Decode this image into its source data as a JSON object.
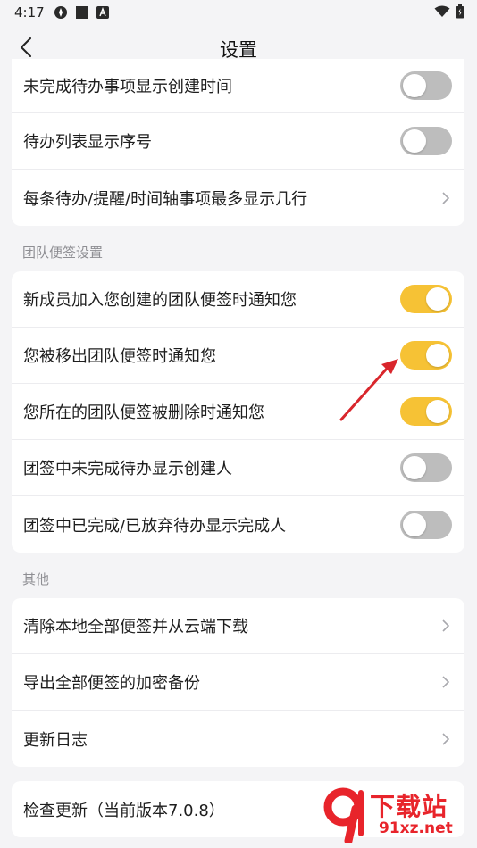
{
  "status": {
    "time": "4:17",
    "icons": [
      "settings-app-icon",
      "square-icon",
      "a-badge-icon",
      "wifi-icon",
      "battery-icon"
    ]
  },
  "header": {
    "title": "设置",
    "back_icon": "back-chevron-icon"
  },
  "group1": {
    "items": [
      {
        "label": "未完成待办事项显示创建时间",
        "control": "toggle",
        "on": false
      },
      {
        "label": "待办列表显示序号",
        "control": "toggle",
        "on": false
      },
      {
        "label": "每条待办/提醒/时间轴事项最多显示几行",
        "control": "chevron"
      }
    ]
  },
  "team": {
    "section_label": "团队便签设置",
    "items": [
      {
        "label": "新成员加入您创建的团队便签时通知您",
        "control": "toggle",
        "on": true
      },
      {
        "label": "您被移出团队便签时通知您",
        "control": "toggle",
        "on": true
      },
      {
        "label": "您所在的团队便签被删除时通知您",
        "control": "toggle",
        "on": true
      },
      {
        "label": "团签中未完成待办显示创建人",
        "control": "toggle",
        "on": false
      },
      {
        "label": "团签中已完成/已放弃待办显示完成人",
        "control": "toggle",
        "on": false
      }
    ]
  },
  "other": {
    "section_label": "其他",
    "items": [
      {
        "label": "清除本地全部便签并从云端下载",
        "control": "chevron"
      },
      {
        "label": "导出全部便签的加密备份",
        "control": "chevron"
      },
      {
        "label": "更新日志",
        "control": "chevron"
      }
    ]
  },
  "update": {
    "label": "检查更新（当前版本7.0.8）"
  },
  "watermark": {
    "text": "下载站",
    "url": "91xz.net"
  },
  "colors": {
    "toggle_on": "#f6c235",
    "toggle_off": "#bdbdbd",
    "background": "#f4f4f6",
    "annotation_arrow": "#d9262c",
    "watermark": "#e8242b"
  }
}
